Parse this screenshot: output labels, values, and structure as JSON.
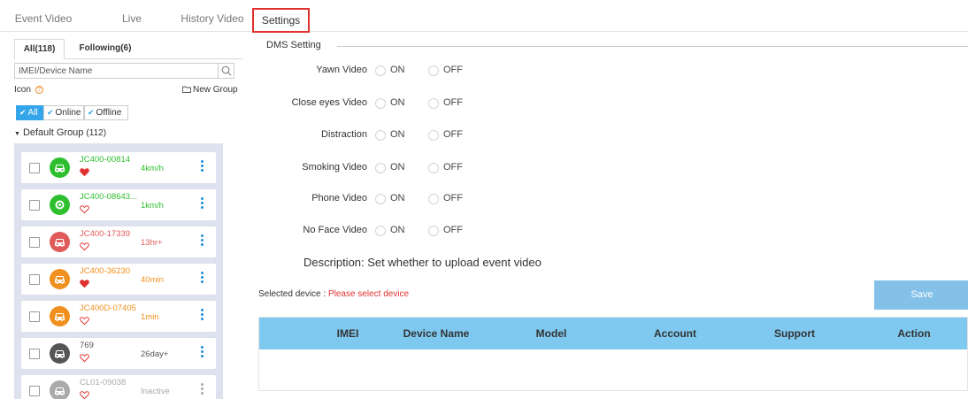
{
  "top_tabs": [
    "Event Video",
    "Live",
    "History Video",
    "Settings"
  ],
  "left": {
    "sub_tabs": [
      "All(118)",
      "Following(6)"
    ],
    "search_placeholder": "IMEI/Device Name",
    "icon_label": "Icon",
    "help_glyph": "?",
    "new_group": "New Group",
    "filters": [
      "All",
      "Online",
      "Offline"
    ],
    "group_name": "Default Group",
    "group_count": "(112)",
    "devices": [
      {
        "name": "JC400-00814",
        "status": "4km/h",
        "color": "#2dbf2d",
        "heart": "filled",
        "icon": "car-icon"
      },
      {
        "name": "JC400-08643...",
        "status": "1km/h",
        "color": "#2dbf2d",
        "heart": "outline",
        "icon": "target-icon"
      },
      {
        "name": "JC400-17339",
        "status": "13hr+",
        "color": "#e05a5a",
        "heart": "outline",
        "icon": "car-icon"
      },
      {
        "name": "JC400-36230",
        "status": "40min",
        "color": "#f0901e",
        "heart": "filled",
        "icon": "car-icon"
      },
      {
        "name": "JC400D-07405",
        "status": "1min",
        "color": "#f0901e",
        "heart": "outline",
        "icon": "car-icon"
      },
      {
        "name": "769",
        "status": "26day+",
        "color": "#555555",
        "heart": "outline",
        "icon": "car-icon"
      },
      {
        "name": "CL01-09038",
        "status": "Inactive",
        "color": "#aaaaaa",
        "heart": "outline",
        "icon": "car-icon"
      }
    ]
  },
  "settings": {
    "section": "DMS Setting",
    "on_label": "ON",
    "off_label": "OFF",
    "options": [
      "Yawn Video",
      "Close eyes Video",
      "Distraction",
      "Smoking Video",
      "Phone Video",
      "No Face Video"
    ],
    "description": "Description:  Set whether to upload event video",
    "selected_prefix": "Selected device : ",
    "selected_value": "Please select device",
    "save": "Save",
    "columns": [
      "IMEI",
      "Device Name",
      "Model",
      "Account",
      "Support",
      "Action"
    ]
  },
  "colors": {
    "accent": "#33a5e8",
    "active_tab_border": "#e0312f",
    "online": "#2dbf2d",
    "heart": "#e0312f",
    "table_header": "#7fc9f0",
    "save_button": "#83c1e8"
  }
}
